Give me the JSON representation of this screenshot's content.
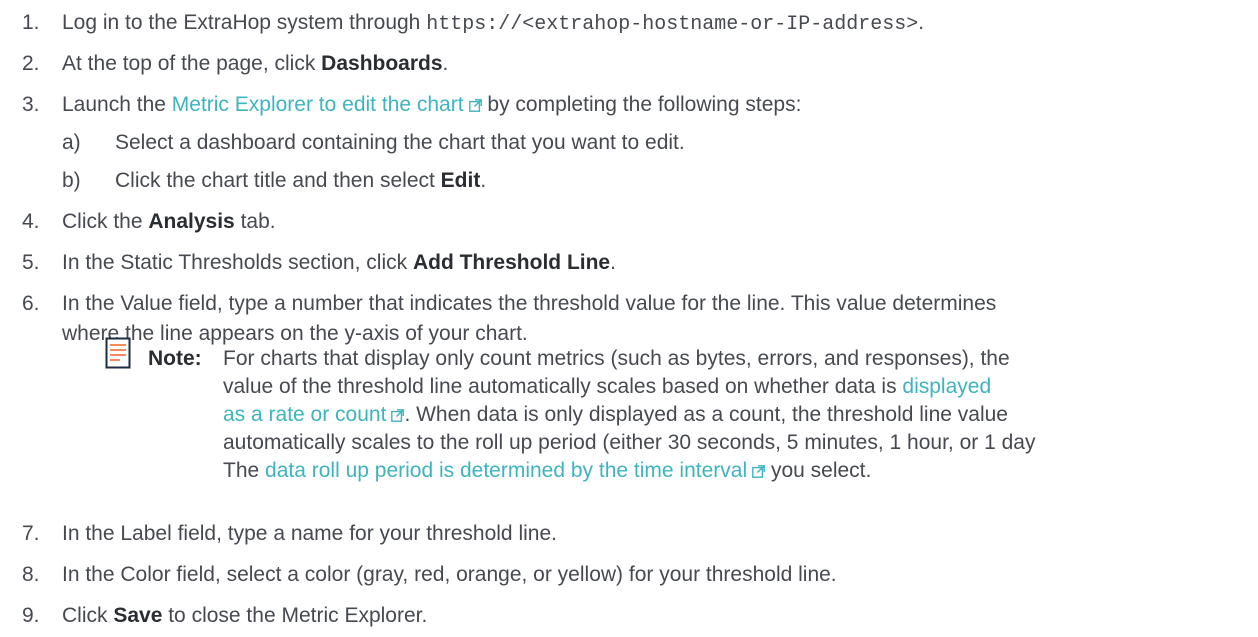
{
  "steps": [
    {
      "num": "1.",
      "pre": "Log in to the ExtraHop system through ",
      "code": "https://<extrahop-hostname-or-IP-address>",
      "post": "."
    },
    {
      "num": "2.",
      "pre": "At the top of the page, click ",
      "bold": "Dashboards",
      "post": "."
    },
    {
      "num": "3.",
      "pre": "Launch the ",
      "link": "Metric Explorer to edit the chart",
      "post": " by completing the following steps:",
      "substeps": [
        {
          "num": "a)",
          "text": "Select a dashboard containing the chart that you want to edit."
        },
        {
          "num": "b)",
          "pre": "Click the chart title and then select ",
          "bold": "Edit",
          "post": "."
        }
      ]
    },
    {
      "num": "4.",
      "pre": "Click the ",
      "bold": "Analysis",
      "post": " tab."
    },
    {
      "num": "5.",
      "pre": "In the Static Thresholds section, click ",
      "bold": "Add Threshold Line",
      "post": "."
    },
    {
      "num": "6.",
      "line1": "In the Value field, type a number that indicates the threshold value for the line. This value determines",
      "line2": "where the line appears on the y-axis of your chart."
    },
    {
      "num": "7.",
      "text": "In the Label field, type a name for your threshold line."
    },
    {
      "num": "8.",
      "text": "In the Color field, select a color (gray, red, orange, or yellow) for your threshold line."
    },
    {
      "num": "9.",
      "pre": "Click ",
      "bold": "Save",
      "post": " to close the Metric Explorer."
    }
  ],
  "note": {
    "label": "Note:",
    "line1": "For charts that display only count metrics (such as bytes, errors, and responses), the",
    "line2_pre": "value of the threshold line automatically scales based on whether data is ",
    "line2_link": "displayed",
    "line3_link": "as a rate or count",
    "line3_post": ". When data is only displayed as a count, the threshold line value",
    "line4": "automatically scales to the roll up period (either 30 seconds, 5 minutes, 1 hour, or 1 day",
    "line5_pre": "The ",
    "line5_link": "data roll up period is determined by the time interval",
    "line5_post": " you select."
  },
  "colors": {
    "text": "#464a50",
    "link": "#3fb4bd",
    "note_icon_lines": "#f28a5b",
    "note_icon_border": "#1f2d44"
  },
  "icons": {
    "external_link": "external-link-icon",
    "note": "note-document-icon"
  }
}
